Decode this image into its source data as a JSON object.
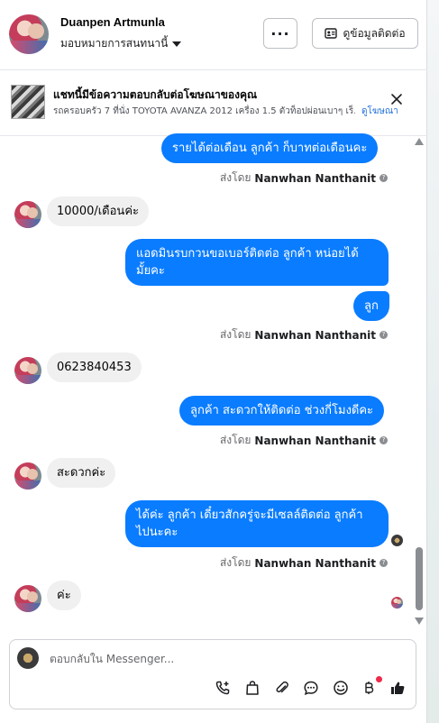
{
  "header": {
    "name": "Duanpen Artmunla",
    "assignment": "มอบหมายการสนทนานี้",
    "more_label": "···",
    "contact_label": "ดูข้อมูลติดต่อ"
  },
  "banner": {
    "title": "แชทนี้มีข้อความตอบกลับต่อโฆษณาของคุณ",
    "text": "รถครอบครัว 7 ที่นั่ง TOYOTA AVANZA 2012 เครื่อง 1.5 ตัวท็อปผ่อนเบาๆ เร็...",
    "link": "ดูโฆษณา"
  },
  "messages": {
    "m1": "รายได้ต่อเดือน  ลูกค้า ก็บาทต่อเดือนคะ",
    "m2": "10000/เดือนค่ะ",
    "m3_l1": "แอดมินรบกวนขอเบอร์ติดต่อ ลูกค้า หน่อยได้",
    "m3_l2": "มั้ยคะ",
    "m4": "ลูก",
    "m5": "0623840453",
    "m6": "ลูกค้า สะดวกให้ติดต่อ ช่วงกี่โมงดีคะ",
    "m7": "สะดวกค่ะ",
    "m8_l1": "ได้ค่ะ  ลูกค้า เดี๋ยวสักครู่จะมีเซลล์ติดต่อ ลูกค้า",
    "m8_l2": "ไปนะคะ",
    "m9": "ค่ะ"
  },
  "sent_by": {
    "prefix": "ส่งโดย",
    "name": "Nanwhan Nanthanit",
    "help": "?"
  },
  "composer": {
    "placeholder": "ตอบกลับใน Messenger..."
  },
  "tools": [
    "call-add-icon",
    "bag-icon",
    "paperclip-icon",
    "chat-bubble-icon",
    "emoji-icon",
    "baht-icon",
    "thumbs-up-icon"
  ],
  "colors": {
    "outgoing_bubble": "#0a7cff",
    "incoming_bubble": "#f0f0f0",
    "link": "#216fdb",
    "notification_dot": "#f02849"
  }
}
